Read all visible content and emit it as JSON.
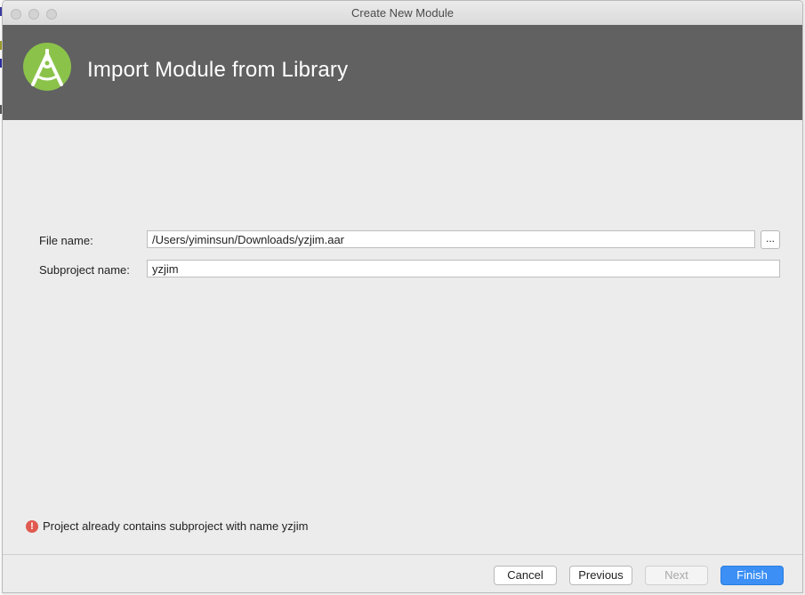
{
  "window": {
    "title": "Create New Module"
  },
  "header": {
    "title": "Import Module from Library",
    "logo_icon": "android-studio-icon"
  },
  "form": {
    "file_name_label": "File name:",
    "file_name_value": "/Users/yiminsun/Downloads/yzjim.aar",
    "browse_label": "...",
    "subproject_label": "Subproject name:",
    "subproject_value": "yzjim"
  },
  "error": {
    "icon": "!",
    "message": "Project already contains subproject with name yzjim"
  },
  "buttons": {
    "cancel": "Cancel",
    "previous": "Previous",
    "next": "Next",
    "finish": "Finish"
  },
  "colors": {
    "header_bg": "#616161",
    "logo_green": "#8bc34a",
    "primary_button": "#3b8ff5",
    "error_red": "#e05a4f"
  }
}
